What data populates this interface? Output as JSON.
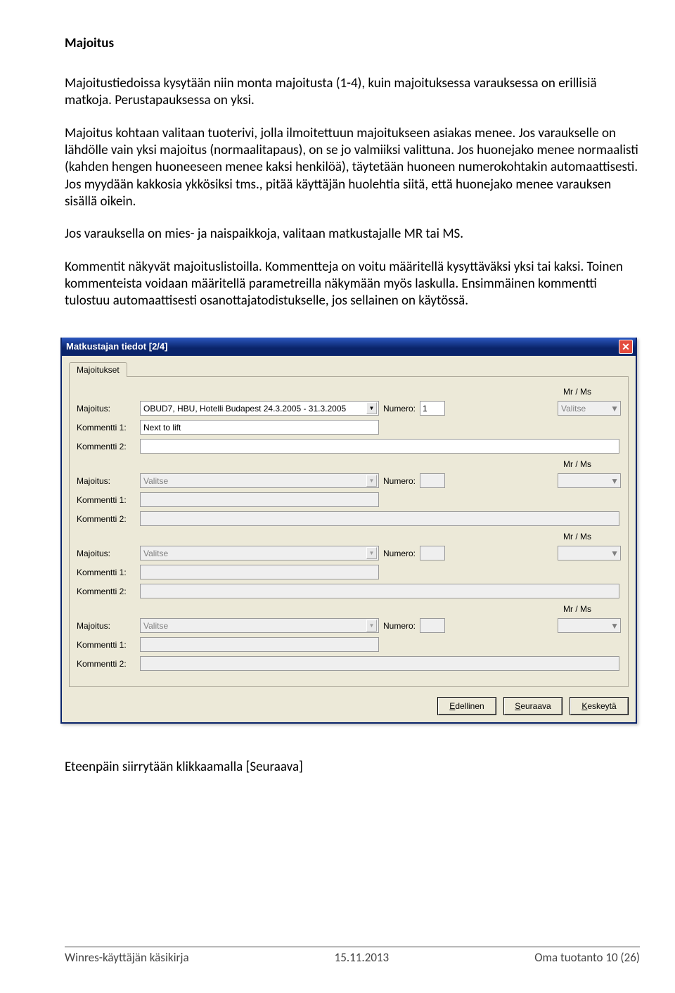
{
  "heading": "Majoitus",
  "para1": "Majoitustiedoissa kysytään niin monta majoitusta (1-4), kuin majoituksessa varauksessa on erillisiä matkoja. Perustapauksessa on yksi.",
  "para2": "Majoitus kohtaan valitaan tuoterivi, jolla ilmoitettuun majoitukseen asiakas menee. Jos varaukselle on lähdölle vain yksi majoitus (normaalitapaus), on se jo valmiiksi valittuna. Jos huonejako menee normaalisti (kahden hengen huoneeseen menee kaksi henkilöä), täytetään huoneen numerokohtakin automaattisesti. Jos myydään kakkosia ykkösiksi tms., pitää käyttäjän huolehtia siitä, että huonejako menee varauksen sisällä oikein.",
  "para3": "Jos varauksella on mies- ja naispaikkoja, valitaan matkustajalle MR tai MS.",
  "para4": "Kommentit näkyvät majoituslistoilla. Kommentteja on voitu määritellä kysyttäväksi yksi tai kaksi. Toinen kommenteista voidaan määritellä parametreilla näkymään myös laskulla. Ensimmäinen kommentti tulostuu automaattisesti osanottajatodistukselle, jos sellainen on käytössä.",
  "dialog": {
    "title": "Matkustajan tiedot [2/4]",
    "tab": "Majoitukset",
    "mrms_header": "Mr / Ms",
    "labels": {
      "majoitus": "Majoitus:",
      "numero": "Numero:",
      "kom1": "Kommentti 1:",
      "kom2": "Kommentti 2:"
    },
    "placeholder_select": "Valitse",
    "groups": [
      {
        "select_value": "OBUD7, HBU, Hotelli Budapest   24.3.2005 - 31.3.2005",
        "select_enabled": true,
        "numero_value": "1",
        "numero_enabled": true,
        "mrms_value": "Valitse",
        "kom1_value": "Next to lift",
        "kom1_enabled": true,
        "kom2_value": "",
        "kom2_enabled": true
      },
      {
        "select_value": "Valitse",
        "select_enabled": false,
        "numero_value": "",
        "numero_enabled": false,
        "mrms_value": "",
        "kom1_value": "",
        "kom1_enabled": false,
        "kom2_value": "",
        "kom2_enabled": false
      },
      {
        "select_value": "Valitse",
        "select_enabled": false,
        "numero_value": "",
        "numero_enabled": false,
        "mrms_value": "",
        "kom1_value": "",
        "kom1_enabled": false,
        "kom2_value": "",
        "kom2_enabled": false
      },
      {
        "select_value": "Valitse",
        "select_enabled": false,
        "numero_value": "",
        "numero_enabled": false,
        "mrms_value": "",
        "kom1_value": "",
        "kom1_enabled": false,
        "kom2_value": "",
        "kom2_enabled": false
      }
    ],
    "buttons": {
      "prev": "Edellinen",
      "next": "Seuraava",
      "cancel": "Keskeytä"
    }
  },
  "after_dialog": "Eteenpäin siirrytään klikkaamalla [Seuraava]",
  "footer": {
    "left": "Winres-käyttäjän käsikirja",
    "center": "15.11.2013",
    "right": "Oma tuotanto 10 (26)"
  }
}
